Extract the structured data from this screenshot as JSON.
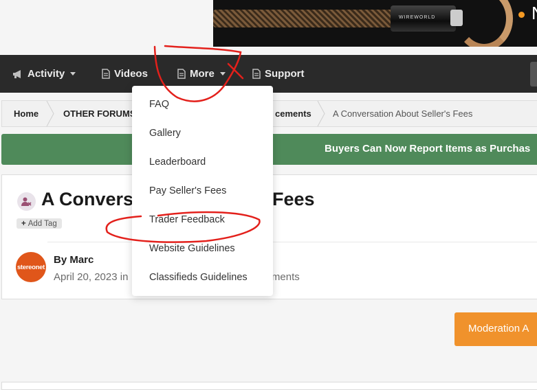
{
  "banner": {
    "brand_text": "WIREWORLD",
    "partial_letter": "N"
  },
  "nav": {
    "items": [
      {
        "label": "Activity",
        "icon": "megaphone-icon",
        "has_caret": true
      },
      {
        "label": "Videos",
        "icon": "document-icon",
        "has_caret": false
      },
      {
        "label": "More",
        "icon": "document-icon",
        "has_caret": true
      },
      {
        "label": "Support",
        "icon": "document-icon",
        "has_caret": false
      }
    ]
  },
  "breadcrumb": {
    "items": [
      "Home",
      "OTHER FORUMS",
      "cements",
      "A Conversation About Seller's Fees"
    ]
  },
  "announcement": {
    "text": "Buyers Can Now Report Items as Purchas"
  },
  "topic": {
    "title": "A Conversation About Seller's Fees",
    "title_visible_left": "A Convers",
    "title_visible_right": "ler's Fees",
    "add_tag_label": "Add Tag",
    "author_prefix": "By ",
    "author": "Marc",
    "date": "April 20, 2023 in",
    "forum_partial": "uncements",
    "avatar_text": "stereonet"
  },
  "moderation": {
    "label": "Moderation A"
  },
  "dropdown": {
    "items": [
      "FAQ",
      "Gallery",
      "Leaderboard",
      "Pay Seller's Fees",
      "Trader Feedback",
      "Website Guidelines",
      "Classifieds Guidelines"
    ]
  },
  "colors": {
    "navbar": "#2a2a2a",
    "announcement": "#4f8a5a",
    "moderation": "#f0922c",
    "avatar": "#e0561a",
    "annotation": "#e3201b"
  }
}
